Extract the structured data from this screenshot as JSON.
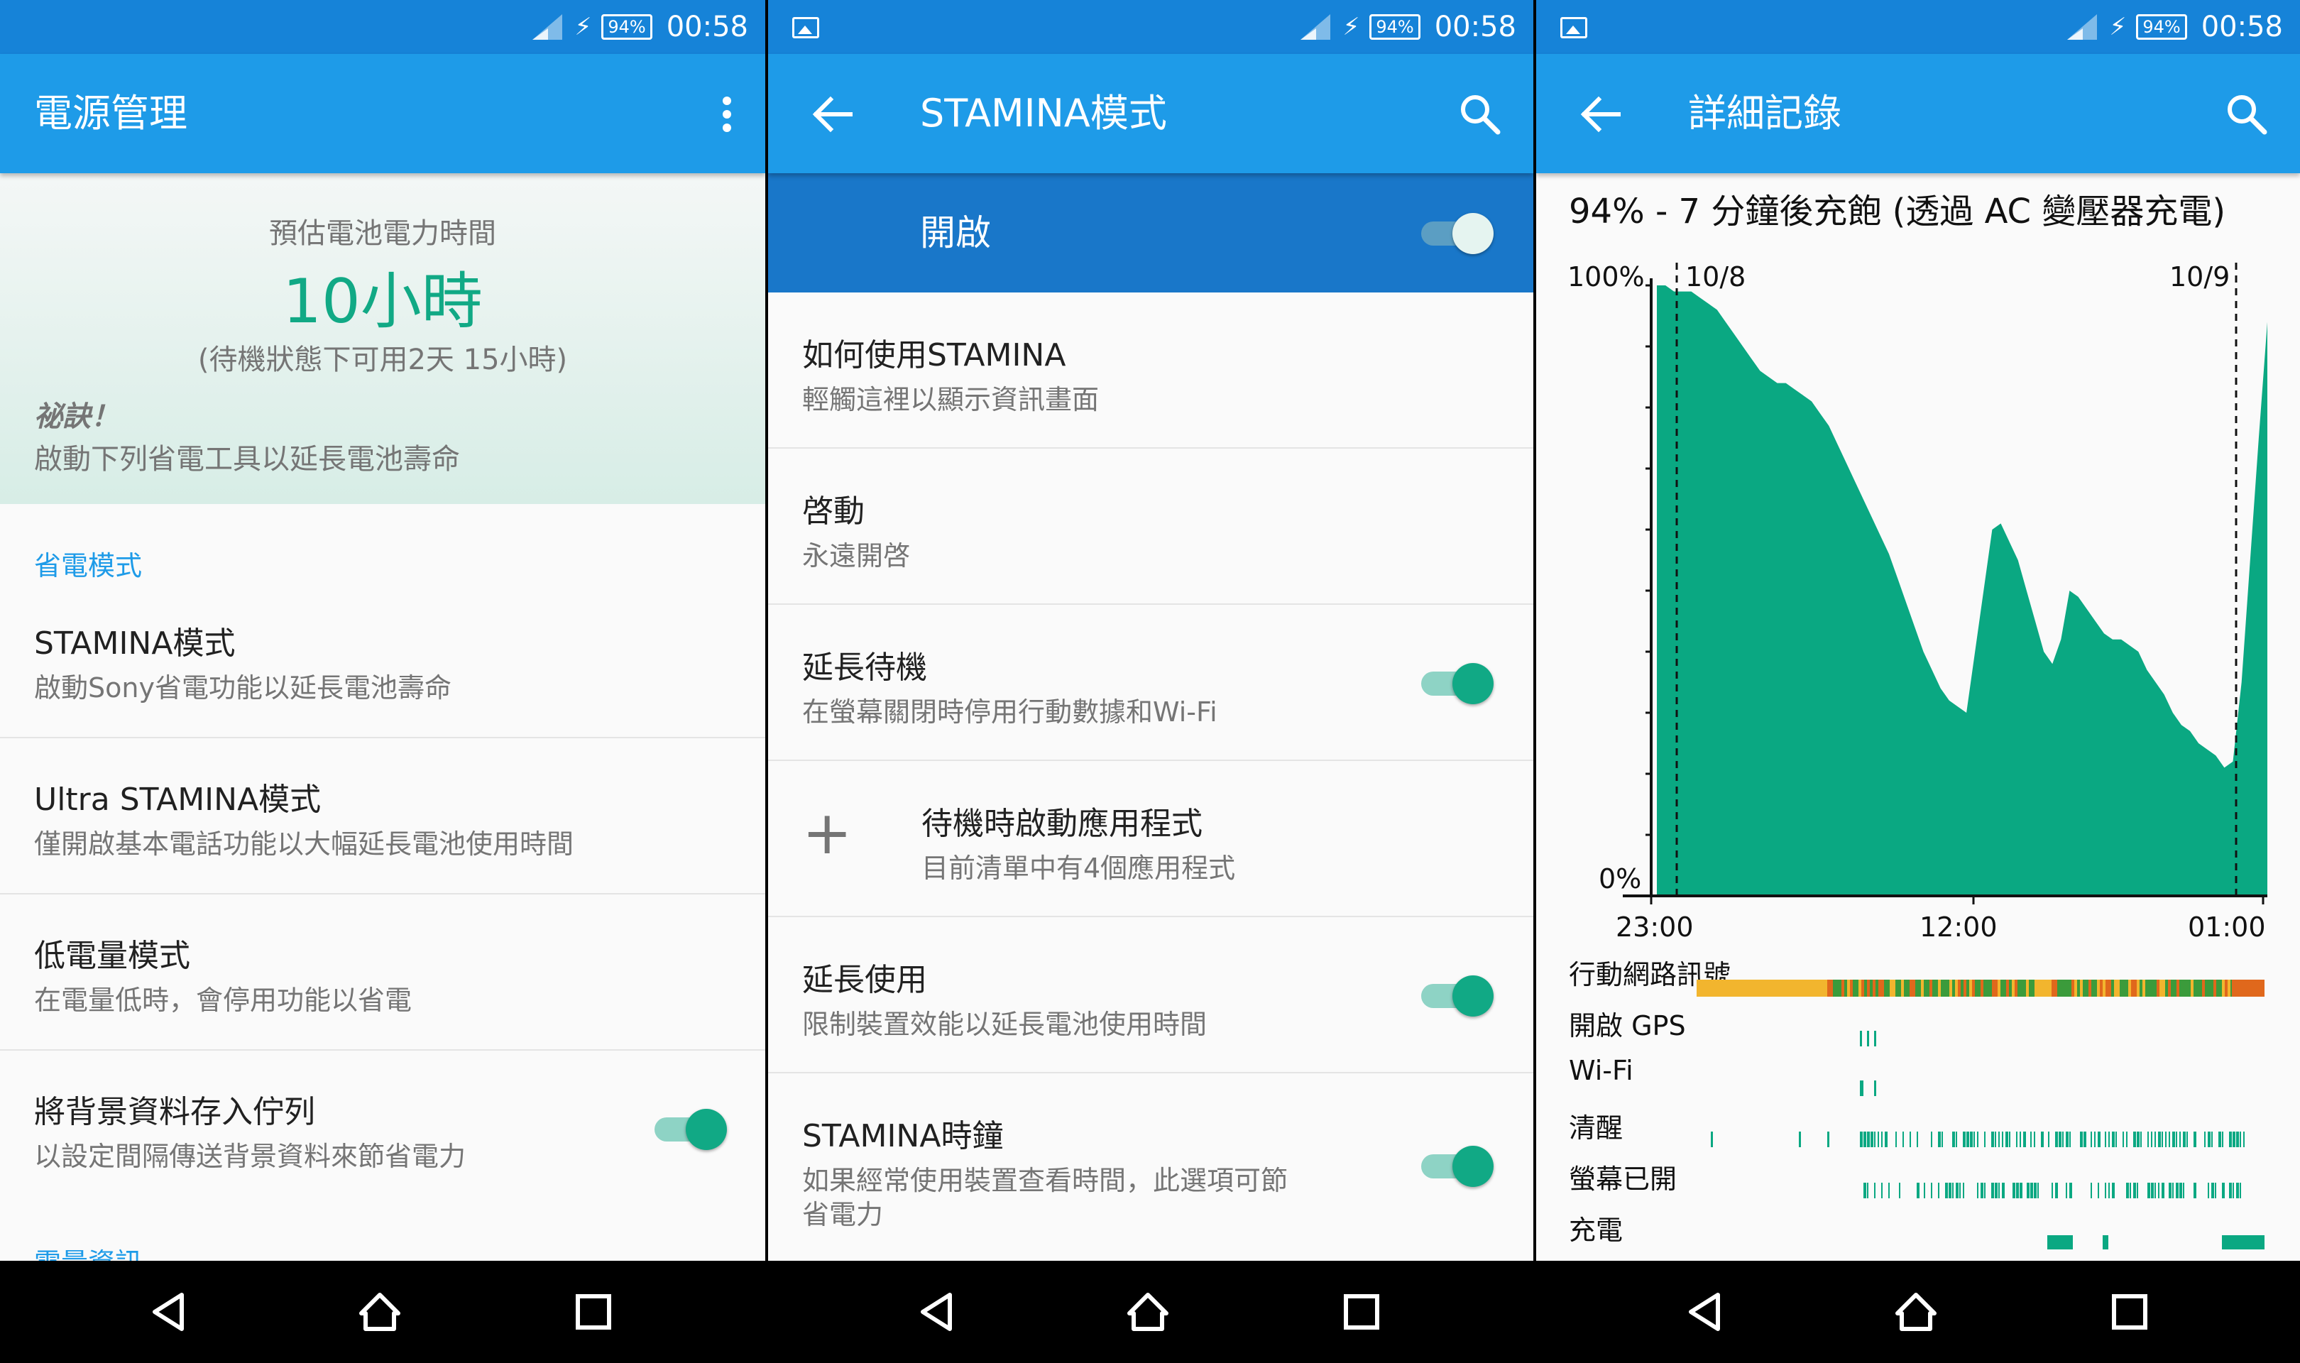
{
  "status": {
    "time": "00:58",
    "battery": "94%"
  },
  "screen1": {
    "title": "電源管理",
    "estimate_label": "預估電池電力時間",
    "estimate_value": "10小時",
    "estimate_standby": "(待機狀態下可用2天 15小時)",
    "tip_title": "祕訣！",
    "tip_text": "啟動下列省電工具以延長電池壽命",
    "section_power_saving": "省電模式",
    "items": [
      {
        "title": "STAMINA模式",
        "subtitle": "啟動Sony省電功能以延長電池壽命"
      },
      {
        "title": "Ultra STAMINA模式",
        "subtitle": "僅開啟基本電話功能以大幅延長電池使用時間"
      },
      {
        "title": "低電量模式",
        "subtitle": "在電量低時，會停用功能以省電"
      },
      {
        "title": "將背景資料存入佇列",
        "subtitle": "以設定間隔傳送背景資料來節省電力",
        "toggle": true
      }
    ],
    "section_partial": "電量資訊"
  },
  "screen2": {
    "title": "STAMINA模式",
    "master_label": "開啟",
    "master_on": true,
    "items": [
      {
        "title": "如何使用STAMINA",
        "subtitle": "輕觸這裡以顯示資訊畫面"
      },
      {
        "title": "啓動",
        "subtitle": "永遠開啓"
      },
      {
        "title": "延長待機",
        "subtitle": "在螢幕關閉時停用行動數據和Wi-Fi",
        "toggle": true
      },
      {
        "title": "待機時啟動應用程式",
        "subtitle": "目前清單中有4個應用程式",
        "icon": "plus-icon"
      },
      {
        "title": "延長使用",
        "subtitle": "限制裝置效能以延長電池使用時間",
        "toggle": true
      },
      {
        "title": "STAMINA時鐘",
        "subtitle": "如果經常使用裝置查看時間，此選項可節",
        "subtitle2": "省電力",
        "toggle": true
      }
    ]
  },
  "screen3": {
    "title": "詳細記錄",
    "summary": "94% - 7 分鐘後充飽 (透過 AC 變壓器充電)",
    "chart_data": {
      "type": "area",
      "ylabel_top": "100%",
      "ylabel_bottom": "0%",
      "ylim": [
        0,
        100
      ],
      "x_ticks": [
        "23:00",
        "12:00",
        "01:00"
      ],
      "day_markers": [
        "10/8",
        "10/9"
      ],
      "fill_color": "#0aa882",
      "series": [
        {
          "values": [
            100,
            100,
            99,
            99,
            99,
            98,
            97,
            96,
            94,
            92,
            90,
            88,
            86,
            85,
            84,
            84,
            83,
            82,
            81,
            79,
            77,
            74,
            71,
            68,
            65,
            62,
            59,
            56,
            52,
            48,
            44,
            40,
            37,
            34,
            32,
            31,
            30,
            40,
            50,
            60,
            61,
            58,
            55,
            50,
            45,
            40,
            38,
            42,
            50,
            49,
            47,
            45,
            43,
            42,
            42,
            41,
            40,
            37,
            35,
            33,
            30,
            28,
            27,
            25,
            24,
            23,
            21,
            22,
            35,
            55,
            75,
            94
          ]
        }
      ]
    },
    "activity_labels": [
      "行動網路訊號",
      "開啟 GPS",
      "Wi-Fi",
      "清醒",
      "螢幕已開",
      "充電"
    ],
    "colors": {
      "signal_strong": "#3b9b3b",
      "signal_mid": "#f2b52e",
      "signal_weak": "#e0681c",
      "activity": "#0aa882"
    }
  },
  "nav": {
    "back": "back-icon",
    "home": "home-icon",
    "recent": "recent-apps-icon"
  }
}
